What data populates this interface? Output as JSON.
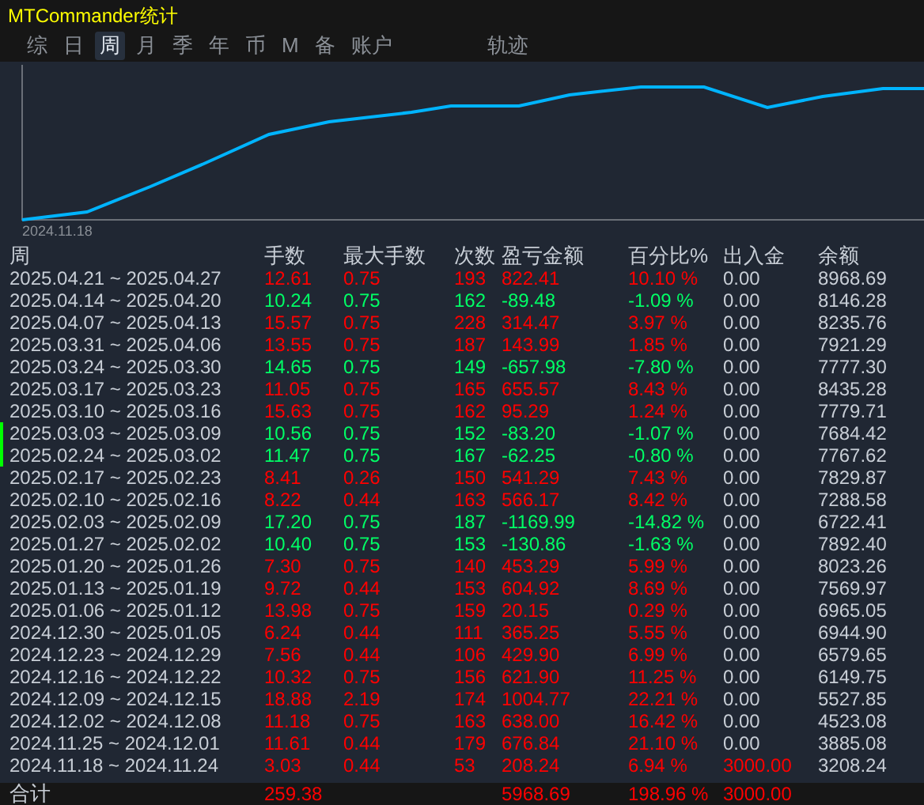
{
  "window": {
    "title": "MTCommander统计"
  },
  "tabs": [
    {
      "label": "综",
      "selected": false
    },
    {
      "label": "日",
      "selected": false
    },
    {
      "label": "周",
      "selected": true
    },
    {
      "label": "月",
      "selected": false
    },
    {
      "label": "季",
      "selected": false
    },
    {
      "label": "年",
      "selected": false
    },
    {
      "label": "币",
      "selected": false
    },
    {
      "label": "M",
      "selected": false
    },
    {
      "label": "备",
      "selected": false
    },
    {
      "label": "账户",
      "selected": false
    },
    {
      "label": "轨迹",
      "selected": false
    }
  ],
  "chart": {
    "start_label": "2024.11.18"
  },
  "table": {
    "columns": [
      "周",
      "手数",
      "最大手数",
      "次数",
      "盈亏金额",
      "百分比%",
      "出入金",
      "余额"
    ],
    "rows": [
      {
        "kind": "gain",
        "marked": false,
        "week": "2025.04.21 ~ 2025.04.27",
        "lots": "12.61",
        "max_lots": "0.75",
        "trades": "193",
        "pnl": "822.41",
        "percent": "10.10 %",
        "deposit": {
          "text": "0.00",
          "highlighted": false
        },
        "balance": "8968.69"
      },
      {
        "kind": "loss",
        "marked": false,
        "week": "2025.04.14 ~ 2025.04.20",
        "lots": "10.24",
        "max_lots": "0.75",
        "trades": "162",
        "pnl": "-89.48",
        "percent": "-1.09 %",
        "deposit": {
          "text": "0.00",
          "highlighted": false
        },
        "balance": "8146.28"
      },
      {
        "kind": "gain",
        "marked": false,
        "week": "2025.04.07 ~ 2025.04.13",
        "lots": "15.57",
        "max_lots": "0.75",
        "trades": "228",
        "pnl": "314.47",
        "percent": "3.97 %",
        "deposit": {
          "text": "0.00",
          "highlighted": false
        },
        "balance": "8235.76"
      },
      {
        "kind": "gain",
        "marked": false,
        "week": "2025.03.31 ~ 2025.04.06",
        "lots": "13.55",
        "max_lots": "0.75",
        "trades": "187",
        "pnl": "143.99",
        "percent": "1.85 %",
        "deposit": {
          "text": "0.00",
          "highlighted": false
        },
        "balance": "7921.29"
      },
      {
        "kind": "loss",
        "marked": false,
        "week": "2025.03.24 ~ 2025.03.30",
        "lots": "14.65",
        "max_lots": "0.75",
        "trades": "149",
        "pnl": "-657.98",
        "percent": "-7.80 %",
        "deposit": {
          "text": "0.00",
          "highlighted": false
        },
        "balance": "7777.30"
      },
      {
        "kind": "gain",
        "marked": false,
        "week": "2025.03.17 ~ 2025.03.23",
        "lots": "11.05",
        "max_lots": "0.75",
        "trades": "165",
        "pnl": "655.57",
        "percent": "8.43 %",
        "deposit": {
          "text": "0.00",
          "highlighted": false
        },
        "balance": "8435.28"
      },
      {
        "kind": "gain",
        "marked": false,
        "week": "2025.03.10 ~ 2025.03.16",
        "lots": "15.63",
        "max_lots": "0.75",
        "trades": "162",
        "pnl": "95.29",
        "percent": "1.24 %",
        "deposit": {
          "text": "0.00",
          "highlighted": false
        },
        "balance": "7779.71"
      },
      {
        "kind": "loss",
        "marked": true,
        "week": "2025.03.03 ~ 2025.03.09",
        "lots": "10.56",
        "max_lots": "0.75",
        "trades": "152",
        "pnl": "-83.20",
        "percent": "-1.07 %",
        "deposit": {
          "text": "0.00",
          "highlighted": false
        },
        "balance": "7684.42"
      },
      {
        "kind": "loss",
        "marked": true,
        "week": "2025.02.24 ~ 2025.03.02",
        "lots": "11.47",
        "max_lots": "0.75",
        "trades": "167",
        "pnl": "-62.25",
        "percent": "-0.80 %",
        "deposit": {
          "text": "0.00",
          "highlighted": false
        },
        "balance": "7767.62"
      },
      {
        "kind": "gain",
        "marked": false,
        "week": "2025.02.17 ~ 2025.02.23",
        "lots": "8.41",
        "max_lots": "0.26",
        "trades": "150",
        "pnl": "541.29",
        "percent": "7.43 %",
        "deposit": {
          "text": "0.00",
          "highlighted": false
        },
        "balance": "7829.87"
      },
      {
        "kind": "gain",
        "marked": false,
        "week": "2025.02.10 ~ 2025.02.16",
        "lots": "8.22",
        "max_lots": "0.44",
        "trades": "163",
        "pnl": "566.17",
        "percent": "8.42 %",
        "deposit": {
          "text": "0.00",
          "highlighted": false
        },
        "balance": "7288.58"
      },
      {
        "kind": "loss",
        "marked": false,
        "week": "2025.02.03 ~ 2025.02.09",
        "lots": "17.20",
        "max_lots": "0.75",
        "trades": "187",
        "pnl": "-1169.99",
        "percent": "-14.82 %",
        "deposit": {
          "text": "0.00",
          "highlighted": false
        },
        "balance": "6722.41"
      },
      {
        "kind": "loss",
        "marked": false,
        "week": "2025.01.27 ~ 2025.02.02",
        "lots": "10.40",
        "max_lots": "0.75",
        "trades": "153",
        "pnl": "-130.86",
        "percent": "-1.63 %",
        "deposit": {
          "text": "0.00",
          "highlighted": false
        },
        "balance": "7892.40"
      },
      {
        "kind": "gain",
        "marked": false,
        "week": "2025.01.20 ~ 2025.01.26",
        "lots": "7.30",
        "max_lots": "0.75",
        "trades": "140",
        "pnl": "453.29",
        "percent": "5.99 %",
        "deposit": {
          "text": "0.00",
          "highlighted": false
        },
        "balance": "8023.26"
      },
      {
        "kind": "gain",
        "marked": false,
        "week": "2025.01.13 ~ 2025.01.19",
        "lots": "9.72",
        "max_lots": "0.44",
        "trades": "153",
        "pnl": "604.92",
        "percent": "8.69 %",
        "deposit": {
          "text": "0.00",
          "highlighted": false
        },
        "balance": "7569.97"
      },
      {
        "kind": "gain",
        "marked": false,
        "week": "2025.01.06 ~ 2025.01.12",
        "lots": "13.98",
        "max_lots": "0.75",
        "trades": "159",
        "pnl": "20.15",
        "percent": "0.29 %",
        "deposit": {
          "text": "0.00",
          "highlighted": false
        },
        "balance": "6965.05"
      },
      {
        "kind": "gain",
        "marked": false,
        "week": "2024.12.30 ~ 2025.01.05",
        "lots": "6.24",
        "max_lots": "0.44",
        "trades": "111",
        "pnl": "365.25",
        "percent": "5.55 %",
        "deposit": {
          "text": "0.00",
          "highlighted": false
        },
        "balance": "6944.90"
      },
      {
        "kind": "gain",
        "marked": false,
        "week": "2024.12.23 ~ 2024.12.29",
        "lots": "7.56",
        "max_lots": "0.44",
        "trades": "106",
        "pnl": "429.90",
        "percent": "6.99 %",
        "deposit": {
          "text": "0.00",
          "highlighted": false
        },
        "balance": "6579.65"
      },
      {
        "kind": "gain",
        "marked": false,
        "week": "2024.12.16 ~ 2024.12.22",
        "lots": "10.32",
        "max_lots": "0.75",
        "trades": "156",
        "pnl": "621.90",
        "percent": "11.25 %",
        "deposit": {
          "text": "0.00",
          "highlighted": false
        },
        "balance": "6149.75"
      },
      {
        "kind": "gain",
        "marked": false,
        "week": "2024.12.09 ~ 2024.12.15",
        "lots": "18.88",
        "max_lots": "2.19",
        "trades": "174",
        "pnl": "1004.77",
        "percent": "22.21 %",
        "deposit": {
          "text": "0.00",
          "highlighted": false
        },
        "balance": "5527.85"
      },
      {
        "kind": "gain",
        "marked": false,
        "week": "2024.12.02 ~ 2024.12.08",
        "lots": "11.18",
        "max_lots": "0.75",
        "trades": "163",
        "pnl": "638.00",
        "percent": "16.42 %",
        "deposit": {
          "text": "0.00",
          "highlighted": false
        },
        "balance": "4523.08"
      },
      {
        "kind": "gain",
        "marked": false,
        "week": "2024.11.25 ~ 2024.12.01",
        "lots": "11.61",
        "max_lots": "0.44",
        "trades": "179",
        "pnl": "676.84",
        "percent": "21.10 %",
        "deposit": {
          "text": "0.00",
          "highlighted": false
        },
        "balance": "3885.08"
      },
      {
        "kind": "gain",
        "marked": false,
        "week": "2024.11.18 ~ 2024.11.24",
        "lots": "3.03",
        "max_lots": "0.44",
        "trades": "53",
        "pnl": "208.24",
        "percent": "6.94 %",
        "deposit": {
          "text": "3000.00",
          "highlighted": true
        },
        "balance": "3208.24"
      }
    ],
    "total": {
      "label": "合计",
      "lots": "259.38",
      "pnl": "5968.69",
      "percent": "198.96 %",
      "deposit": "3000.00"
    }
  }
}
